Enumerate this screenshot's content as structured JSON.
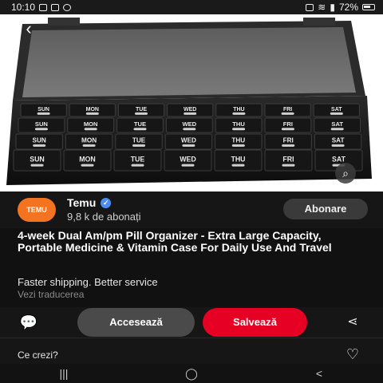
{
  "status_bar": {
    "time": "10:10",
    "battery": "72%",
    "left_icons": [
      "image-icon",
      "email-icon",
      "whatsapp-icon"
    ],
    "right_icons": [
      "alarm-icon",
      "wifi-icon",
      "signal-icon",
      "battery-icon"
    ]
  },
  "hero": {
    "back_icon": "back-arrow-icon",
    "lens_icon": "visual-search-icon",
    "organizer": {
      "rows": [
        [
          "SUN",
          "MON",
          "TUE",
          "WED",
          "THU",
          "FRI",
          "SAT"
        ],
        [
          "SUN",
          "MON",
          "TUE",
          "WED",
          "THU",
          "FRI",
          "SAT"
        ],
        [
          "SUN",
          "MON",
          "TUE",
          "WED",
          "THU",
          "FRI",
          "SAT"
        ],
        [
          "SUN",
          "MON",
          "TUE",
          "WED",
          "THU",
          "FRI",
          "SAT"
        ]
      ]
    }
  },
  "channel": {
    "name": "Temu",
    "avatar_text": "TEMU",
    "subscribers": "9,8 k de abonați",
    "subscribe_label": "Abonare",
    "accent": "#f47321"
  },
  "pin": {
    "title": "4-week Dual Am/pm Pill Organizer - Extra Large Capacity, Portable Medicine & Vitamin Case For Daily Use And Travel",
    "tagline": "Faster shipping. Better service",
    "translate": "Vezi traducerea"
  },
  "actions": {
    "access_label": "Accesează",
    "save_label": "Salvează",
    "save_color": "#e60023"
  },
  "comment": {
    "prompt": "Ce crezi?"
  },
  "nav": {
    "recent": "|||",
    "home": "◯",
    "back": "<"
  }
}
